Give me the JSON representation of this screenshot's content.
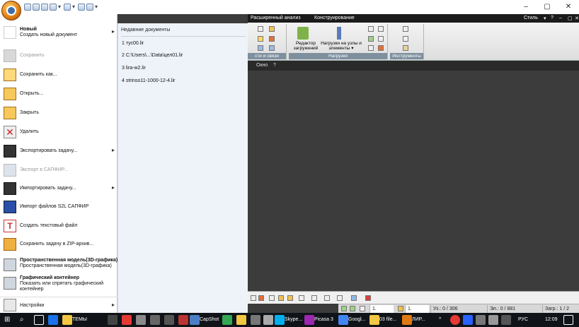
{
  "titlebar": {
    "style_label": "Стиль",
    "controls": [
      "–",
      "▢",
      "✕"
    ]
  },
  "ribbon": {
    "tabs": [
      "Расширенный анализ",
      "Конструирование"
    ],
    "groups": [
      {
        "label": "сти и связи"
      },
      {
        "label": "Нагрузки",
        "buttons": [
          "Редактор загружений",
          "Нагрузки на узлы и элементы ▾"
        ]
      },
      {
        "label": "Инструменты"
      }
    ]
  },
  "menuband": {
    "items": [
      "Окно",
      "?"
    ]
  },
  "leftmenu": {
    "new": {
      "title": "Новый",
      "sub": "Создать новый документ"
    },
    "items": [
      {
        "label": "Сохранить",
        "disabled": true
      },
      {
        "label": "Сохранить как..."
      },
      {
        "label": "Открыть..."
      },
      {
        "label": "Закрыть"
      },
      {
        "label": "Удалить"
      },
      {
        "label": "Экспортировать задачу..."
      },
      {
        "label": "Экспорт в САПФИР...",
        "disabled": true
      },
      {
        "label": "Импортировать задачу..."
      },
      {
        "label": "Импорт файлов S2L САПФИР"
      },
      {
        "label": "Создать текстовый файл"
      },
      {
        "label": "Сохранить задачу в ZIP-архив..."
      }
    ],
    "spatial": {
      "title": "Пространственная модель(3D-графика)",
      "sub": "Пространственная модель(3D-графика)"
    },
    "graphic": {
      "title": "Графический контейнер",
      "sub": "Показать или спрятать графический контейнер"
    },
    "settings": {
      "label": "Настройки"
    }
  },
  "recent": {
    "header": "Недавние документы",
    "items": [
      "1 тус00.lir",
      "2 C:\\Users\\...\\Data\\цел01.lir",
      "3 lira-w2.lir",
      "4 strinso11-1000-12-4.lir"
    ]
  },
  "statusbar": {
    "combo1": "1.",
    "combo2": "1.",
    "us": "Уз.: 0 / 306",
    "el": "Эл.: 0 / 881",
    "zagr": "Загр.: 1 / 2"
  },
  "taskbar": {
    "items": [
      "ТЕМЫ",
      "CapShot",
      "Skype...",
      "Picasa 3",
      "Googl...",
      "03 file...",
      "ЛИР..."
    ],
    "lang": "РУС",
    "time": "12:09"
  }
}
